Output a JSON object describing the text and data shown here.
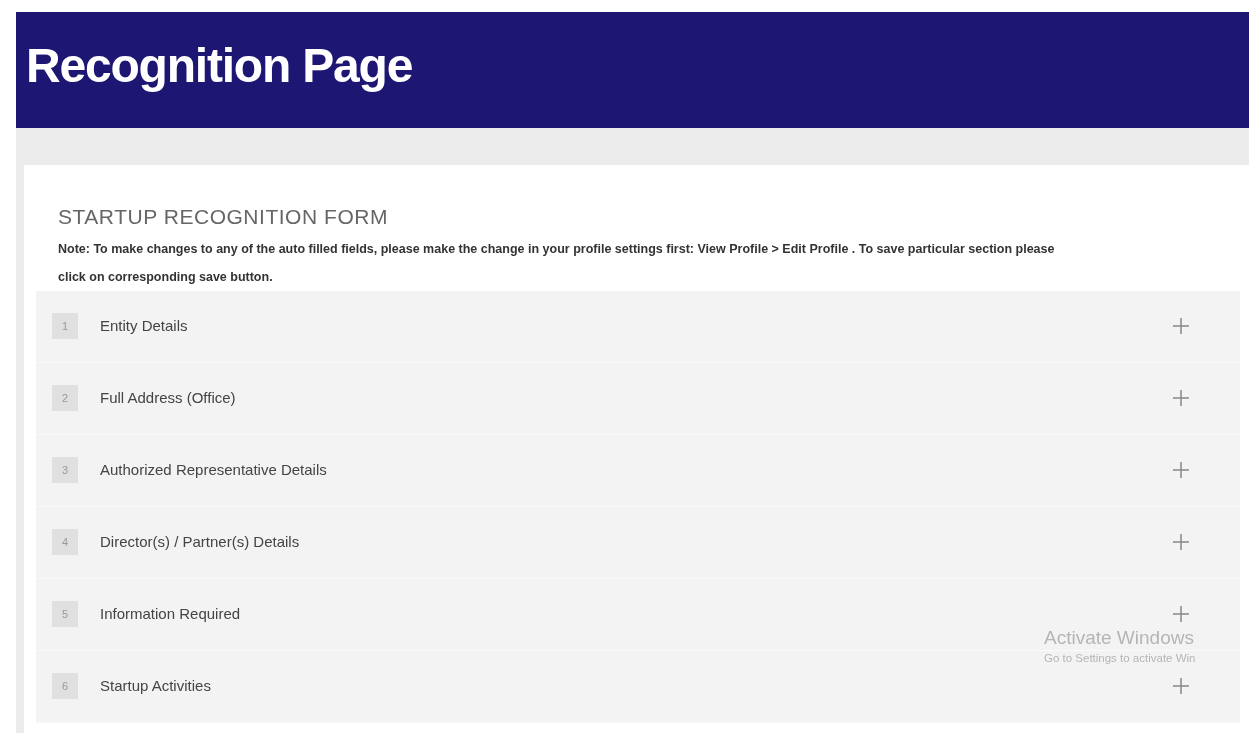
{
  "header": {
    "title": "Recognition Page"
  },
  "form": {
    "title": "STARTUP RECOGNITION FORM",
    "note": "Note: To make changes to any of the auto filled fields, please make the change in your profile settings first: View Profile > Edit Profile . To save particular section please click on corresponding save button.",
    "sections": [
      {
        "number": "1",
        "label": "Entity Details",
        "expanded": false
      },
      {
        "number": "2",
        "label": "Full Address (Office)",
        "expanded": false
      },
      {
        "number": "3",
        "label": "Authorized Representative Details",
        "expanded": false
      },
      {
        "number": "4",
        "label": "Director(s) / Partner(s) Details",
        "expanded": false
      },
      {
        "number": "5",
        "label": "Information Required",
        "expanded": false
      },
      {
        "number": "6",
        "label": "Startup Activities",
        "expanded": false
      }
    ]
  },
  "activation_notice": {
    "title": "Activate Windows",
    "message": "Go to Settings to activate Win"
  }
}
